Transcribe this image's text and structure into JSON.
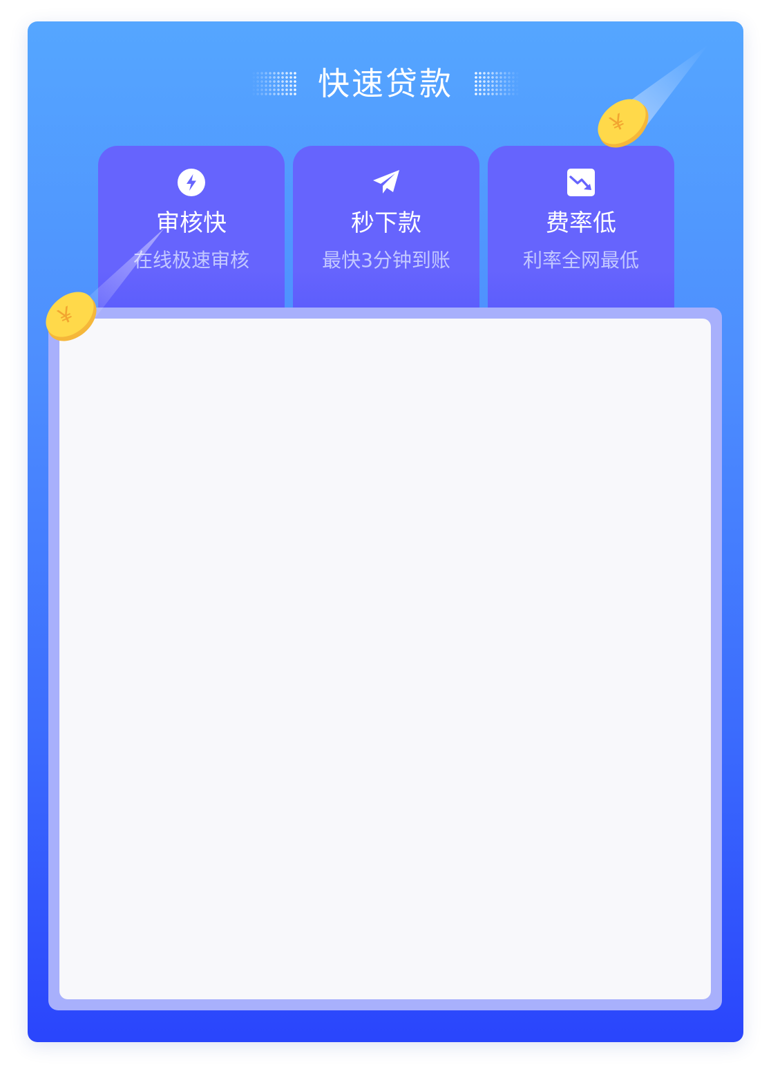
{
  "header": {
    "title": "快速贷款"
  },
  "features": [
    {
      "icon": "lightning-icon",
      "name": "审核快",
      "desc": "在线极速审核"
    },
    {
      "icon": "paper-plane-icon",
      "name": "秒下款",
      "desc": "最快3分钟到账"
    },
    {
      "icon": "trend-down-icon",
      "name": "费率低",
      "desc": "利率全网最低"
    }
  ],
  "coin": {
    "symbol": "¥"
  },
  "colors": {
    "card_top": "#55a6ff",
    "card_bottom": "#2a45fc",
    "feature_bg": "#6664fd",
    "panel_border": "#a8b0fc",
    "panel_bg": "#f8f8fb",
    "coin_gold": "#ffd94a",
    "coin_edge": "#f5b73a"
  }
}
